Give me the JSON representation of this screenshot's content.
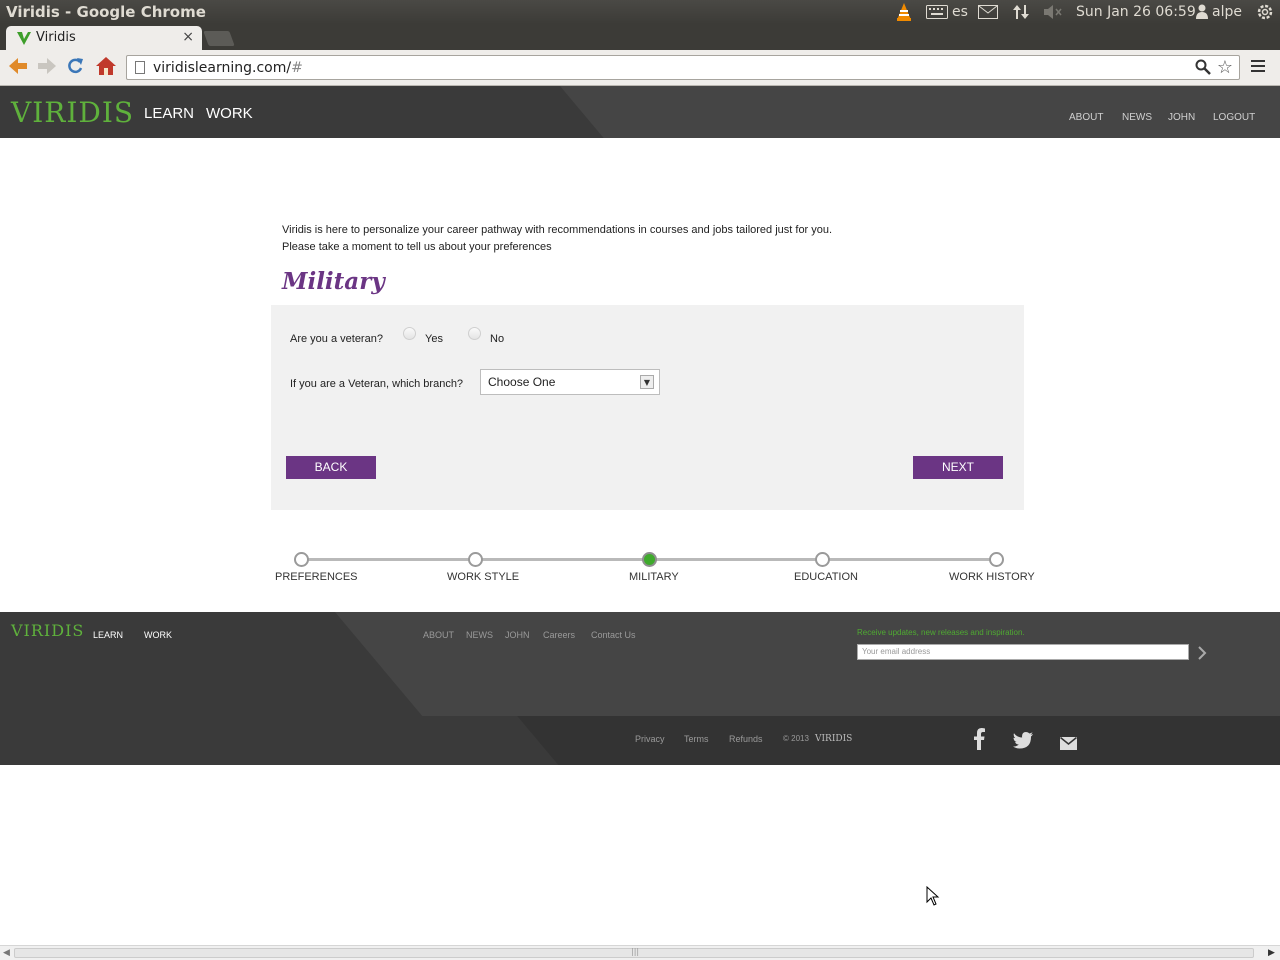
{
  "os": {
    "window_title": "Viridis - Google Chrome",
    "lang": "es",
    "datetime": "Sun Jan 26 06:59",
    "user": "alpe"
  },
  "browser": {
    "tab_title": "Viridis",
    "url_main": "viridislearning.com/",
    "url_hash": "#"
  },
  "header": {
    "logo": "VIRIDIS",
    "nav": [
      "LEARN",
      "WORK"
    ],
    "links": [
      "ABOUT",
      "NEWS",
      "JOHN",
      "LOGOUT"
    ]
  },
  "intro": {
    "line1": "Viridis is here to personalize your career pathway with recommendations in courses and jobs tailored just for you.",
    "line2": "Please take a moment to tell us about your preferences"
  },
  "section_title": "Military",
  "form": {
    "veteran_question": "Are you a veteran?",
    "yes_label": "Yes",
    "no_label": "No",
    "branch_question": "If you are a Veteran, which branch?",
    "branch_selected": "Choose One",
    "back_label": "BACK",
    "next_label": "NEXT"
  },
  "progress": {
    "steps": [
      "PREFERENCES",
      "WORK STYLE",
      "MILITARY",
      "EDUCATION",
      "WORK HISTORY"
    ],
    "active_index": 2
  },
  "footer": {
    "logo": "VIRIDIS",
    "nav": [
      "LEARN",
      "WORK"
    ],
    "links": [
      "ABOUT",
      "NEWS",
      "JOHN",
      "Careers",
      "Contact Us"
    ],
    "subscribe_text": "Receive updates, new releases and inspiration.",
    "email_placeholder": "Your email address",
    "bottom_links": [
      "Privacy",
      "Terms",
      "Refunds"
    ],
    "copyright": "© 2013",
    "copyright_logo": "VIRIDIS"
  },
  "colors": {
    "brand_green": "#5fb13c",
    "brand_purple": "#6b3584",
    "header_dark": "#3a3a3a"
  }
}
